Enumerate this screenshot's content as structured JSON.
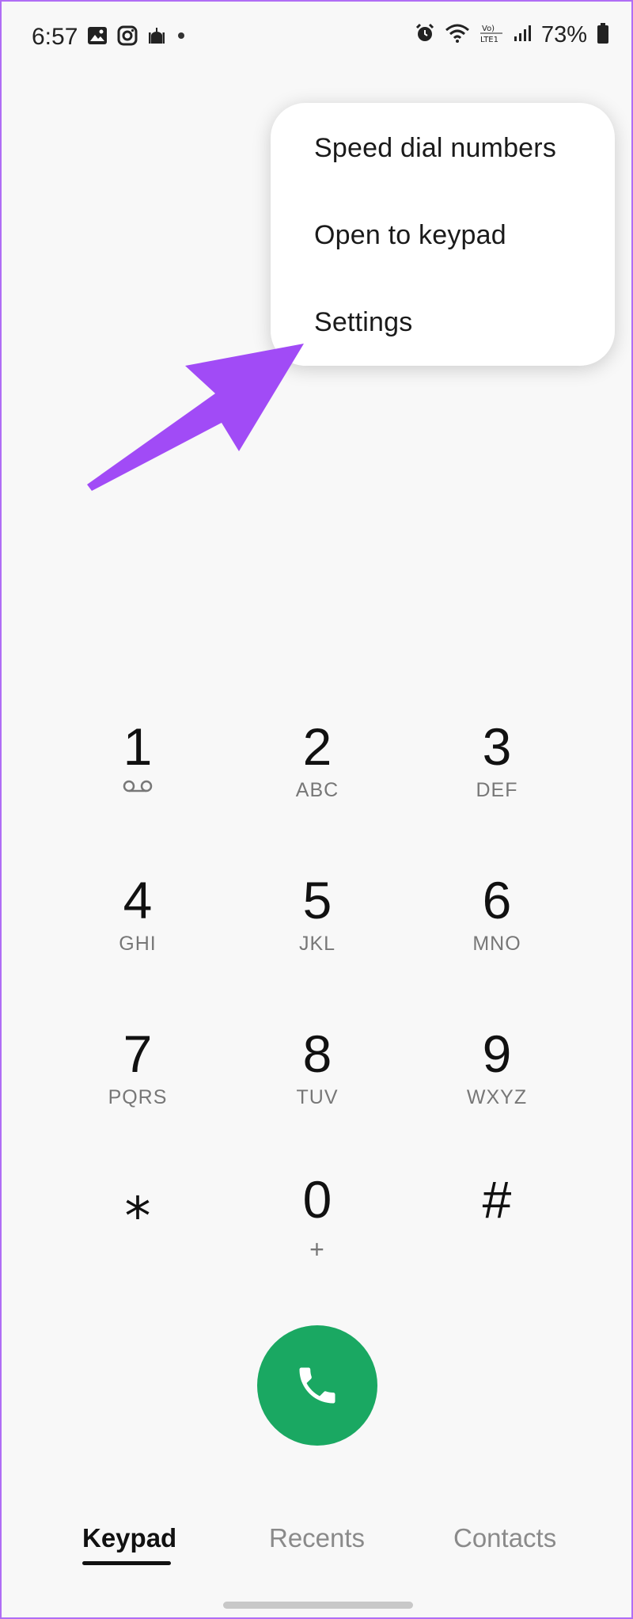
{
  "status_bar": {
    "time": "6:57",
    "battery_percent": "73%",
    "left_icons": [
      "gallery-icon",
      "instagram-icon",
      "mosque-icon",
      "notification-dot-icon"
    ],
    "right_icons": [
      "alarm-icon",
      "wifi-calling-icon",
      "volte-icon",
      "signal-icon",
      "battery-icon"
    ]
  },
  "menu": {
    "items": [
      {
        "label": "Speed dial numbers"
      },
      {
        "label": "Open to keypad"
      },
      {
        "label": "Settings"
      }
    ]
  },
  "annotation": {
    "arrow_color": "#a14bf6"
  },
  "keypad": {
    "keys": [
      {
        "digit": "1",
        "letters": "",
        "sub_icon": "voicemail-icon"
      },
      {
        "digit": "2",
        "letters": "ABC"
      },
      {
        "digit": "3",
        "letters": "DEF"
      },
      {
        "digit": "4",
        "letters": "GHI"
      },
      {
        "digit": "5",
        "letters": "JKL"
      },
      {
        "digit": "6",
        "letters": "MNO"
      },
      {
        "digit": "7",
        "letters": "PQRS"
      },
      {
        "digit": "8",
        "letters": "TUV"
      },
      {
        "digit": "9",
        "letters": "WXYZ"
      },
      {
        "digit": "⁎",
        "letters": ""
      },
      {
        "digit": "0",
        "letters": "+"
      },
      {
        "digit": "#",
        "letters": ""
      }
    ]
  },
  "call_button": {
    "icon": "phone-icon",
    "color": "#1aa862"
  },
  "bottom_nav": {
    "tabs": [
      {
        "label": "Keypad",
        "active": true
      },
      {
        "label": "Recents",
        "active": false
      },
      {
        "label": "Contacts",
        "active": false
      }
    ]
  }
}
